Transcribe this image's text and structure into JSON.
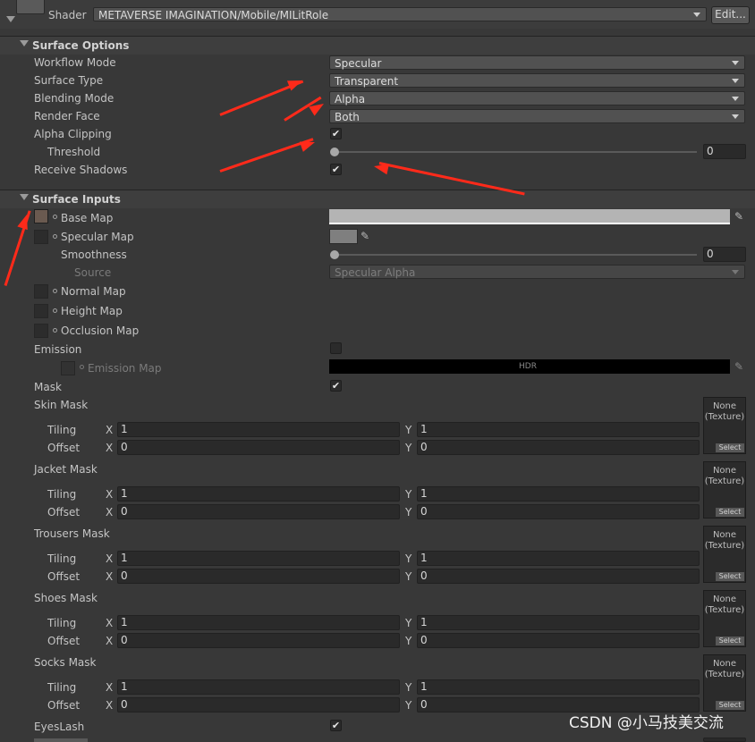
{
  "shader": {
    "label": "Shader",
    "value": "METAVERSE IMAGINATION/Mobile/MILitRole",
    "edit_button": "Edit..."
  },
  "surface_options": {
    "header": "Surface Options",
    "workflow_mode": {
      "label": "Workflow Mode",
      "value": "Specular"
    },
    "surface_type": {
      "label": "Surface Type",
      "value": "Transparent"
    },
    "blending_mode": {
      "label": "Blending Mode",
      "value": "Alpha"
    },
    "render_face": {
      "label": "Render Face",
      "value": "Both"
    },
    "alpha_clipping": {
      "label": "Alpha Clipping",
      "checked": true
    },
    "threshold": {
      "label": "Threshold",
      "value": "0",
      "fraction": 0
    },
    "receive_shadows": {
      "label": "Receive Shadows",
      "checked": true
    }
  },
  "surface_inputs": {
    "header": "Surface Inputs",
    "base_map": {
      "label": "Base Map",
      "color": "#b4b4b4"
    },
    "specular_map": {
      "label": "Specular Map",
      "color": "#7f7f7f"
    },
    "smoothness": {
      "label": "Smoothness",
      "value": "0",
      "fraction": 0
    },
    "source": {
      "label": "Source",
      "value": "Specular Alpha"
    },
    "normal_map": {
      "label": "Normal Map"
    },
    "height_map": {
      "label": "Height Map"
    },
    "occlusion_map": {
      "label": "Occlusion Map"
    },
    "emission": {
      "label": "Emission",
      "checked": false
    },
    "emission_map": {
      "label": "Emission Map",
      "hdr_label": "HDR",
      "color": "#000000"
    },
    "mask": {
      "label": "Mask",
      "checked": true
    },
    "tiling_label": "Tiling",
    "offset_label": "Offset",
    "x_label": "X",
    "y_label": "Y",
    "none_texture_line1": "None",
    "none_texture_line2": "(Texture)",
    "select_label": "Select",
    "masks": [
      {
        "label": "Skin Mask",
        "tiling_x": "1",
        "tiling_y": "1",
        "offset_x": "0",
        "offset_y": "0"
      },
      {
        "label": "Jacket Mask",
        "tiling_x": "1",
        "tiling_y": "1",
        "offset_x": "0",
        "offset_y": "0"
      },
      {
        "label": "Trousers Mask",
        "tiling_x": "1",
        "tiling_y": "1",
        "offset_x": "0",
        "offset_y": "0"
      },
      {
        "label": "Shoes Mask",
        "tiling_x": "1",
        "tiling_y": "1",
        "offset_x": "0",
        "offset_y": "0"
      },
      {
        "label": "Socks Mask",
        "tiling_x": "1",
        "tiling_y": "1",
        "offset_x": "0",
        "offset_y": "0"
      }
    ],
    "eyeslash": {
      "label": "EyesLash",
      "checked": true
    }
  },
  "watermark": "CSDN @小马技美交流",
  "colors": {
    "annotation_arrow": "#ff2a1a",
    "panel_bg": "#383838"
  }
}
